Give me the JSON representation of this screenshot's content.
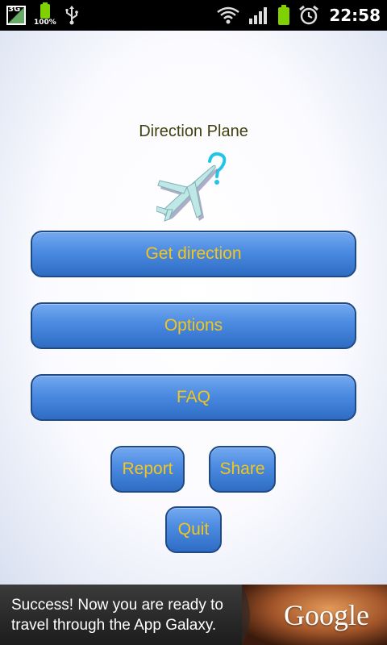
{
  "status_bar": {
    "network": "3G",
    "battery_percent": "100%",
    "time": "22:58"
  },
  "app": {
    "title": "Direction Plane",
    "logo": "plane-question-icon",
    "buttons": {
      "get_direction": "Get direction",
      "options": "Options",
      "faq": "FAQ",
      "report": "Report",
      "share": "Share",
      "quit": "Quit"
    }
  },
  "ad": {
    "line1": "Success! Now you are ready to",
    "line2": "travel through the App Galaxy.",
    "brand": "Google"
  },
  "colors": {
    "button_fill": "#4a8ae0",
    "button_border": "#1f4a86",
    "button_text": "#f5c518",
    "title_text": "#404010",
    "battery_green": "#7fd100"
  }
}
